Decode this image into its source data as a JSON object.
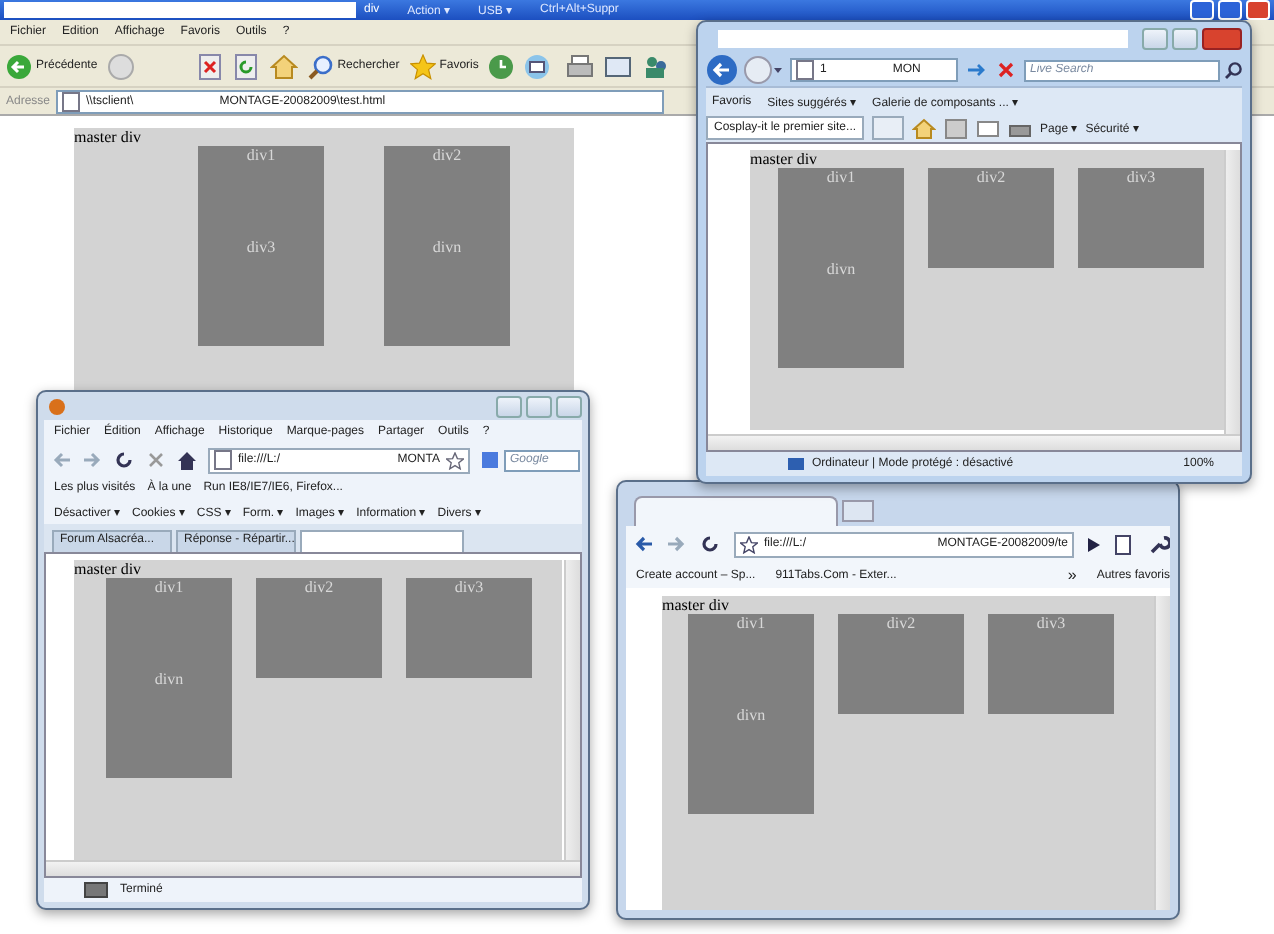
{
  "desktop_window": {
    "title": "div",
    "title_bar_items": [
      "Action ▾",
      "USB ▾",
      "Ctrl+Alt+Suppr"
    ],
    "menu": [
      "Fichier",
      "Edition",
      "Affichage",
      "Favoris",
      "Outils",
      "?"
    ],
    "toolbar": [
      {
        "kind": "back",
        "label": "Précédente"
      },
      {
        "kind": "search",
        "label": "Rechercher"
      },
      {
        "kind": "favorites",
        "label": "Favoris"
      }
    ],
    "address_label": "Adresse",
    "address": [
      "\\\\tsclient\\",
      "MONTAGE-20082009\\test.html"
    ],
    "page": {
      "label": "master div",
      "boxes": [
        {
          "kind": "tall",
          "label": "div1",
          "inner": "div3"
        },
        {
          "kind": "tall",
          "label": "div2",
          "inner": "divn"
        }
      ]
    }
  },
  "ie_window": {
    "address": [
      "1",
      "MON"
    ],
    "search": {
      "placeholder": "Live Search"
    },
    "favorites_bar": [
      "Favoris",
      "Sites suggérés ▾",
      "Galerie de composants ... ▾"
    ],
    "tabs": [
      {
        "label": "Cosplay-it le premier site...",
        "selected": true
      }
    ],
    "commands": [
      "Page ▾",
      "Sécurité ▾"
    ],
    "page": {
      "label": "master div",
      "boxes": [
        {
          "kind": "tall",
          "label": "div1",
          "inner": "divn"
        },
        {
          "kind": "short",
          "label": "div2"
        },
        {
          "kind": "short",
          "label": "div3"
        }
      ]
    },
    "status": "Ordinateur | Mode protégé : désactivé",
    "zoom": "100%"
  },
  "firefox_window": {
    "menu": [
      "Fichier",
      "Édition",
      "Affichage",
      "Historique",
      "Marque-pages",
      "Partager",
      "Outils",
      "?"
    ],
    "address": [
      "file:///L:/",
      "MONTA"
    ],
    "search": {
      "placeholder": "Google"
    },
    "bookmarks": [
      "Les plus visités",
      "À la une",
      "Run IE8/IE7/IE6, Firefox..."
    ],
    "dev_toolbar": [
      "Désactiver ▾",
      "Cookies ▾",
      "CSS ▾",
      "Form. ▾",
      "Images ▾",
      "Information ▾",
      "Divers ▾"
    ],
    "tabs": [
      {
        "label": "Forum Alsacréa...",
        "selected": false
      },
      {
        "label": "Réponse - Répartir...",
        "selected": false
      },
      {
        "selected": true
      }
    ],
    "page": {
      "label": "master div",
      "boxes": [
        {
          "kind": "tall",
          "label": "div1",
          "inner": "divn"
        },
        {
          "kind": "short",
          "label": "div2"
        },
        {
          "kind": "short",
          "label": "div3"
        }
      ]
    },
    "status": "Terminé"
  },
  "chrome_window": {
    "address": [
      "file:///L:/",
      "MONTAGE-20082009/te"
    ],
    "bookmarks": [
      "Create account – Sp...",
      "911Tabs.Com - Exter..."
    ],
    "more": "»",
    "other_bookmarks": "Autres favoris",
    "page": {
      "label": "master div",
      "boxes": [
        {
          "kind": "tall",
          "label": "div1",
          "inner": "divn"
        },
        {
          "kind": "short",
          "label": "div2"
        },
        {
          "kind": "short",
          "label": "div3"
        }
      ]
    }
  }
}
